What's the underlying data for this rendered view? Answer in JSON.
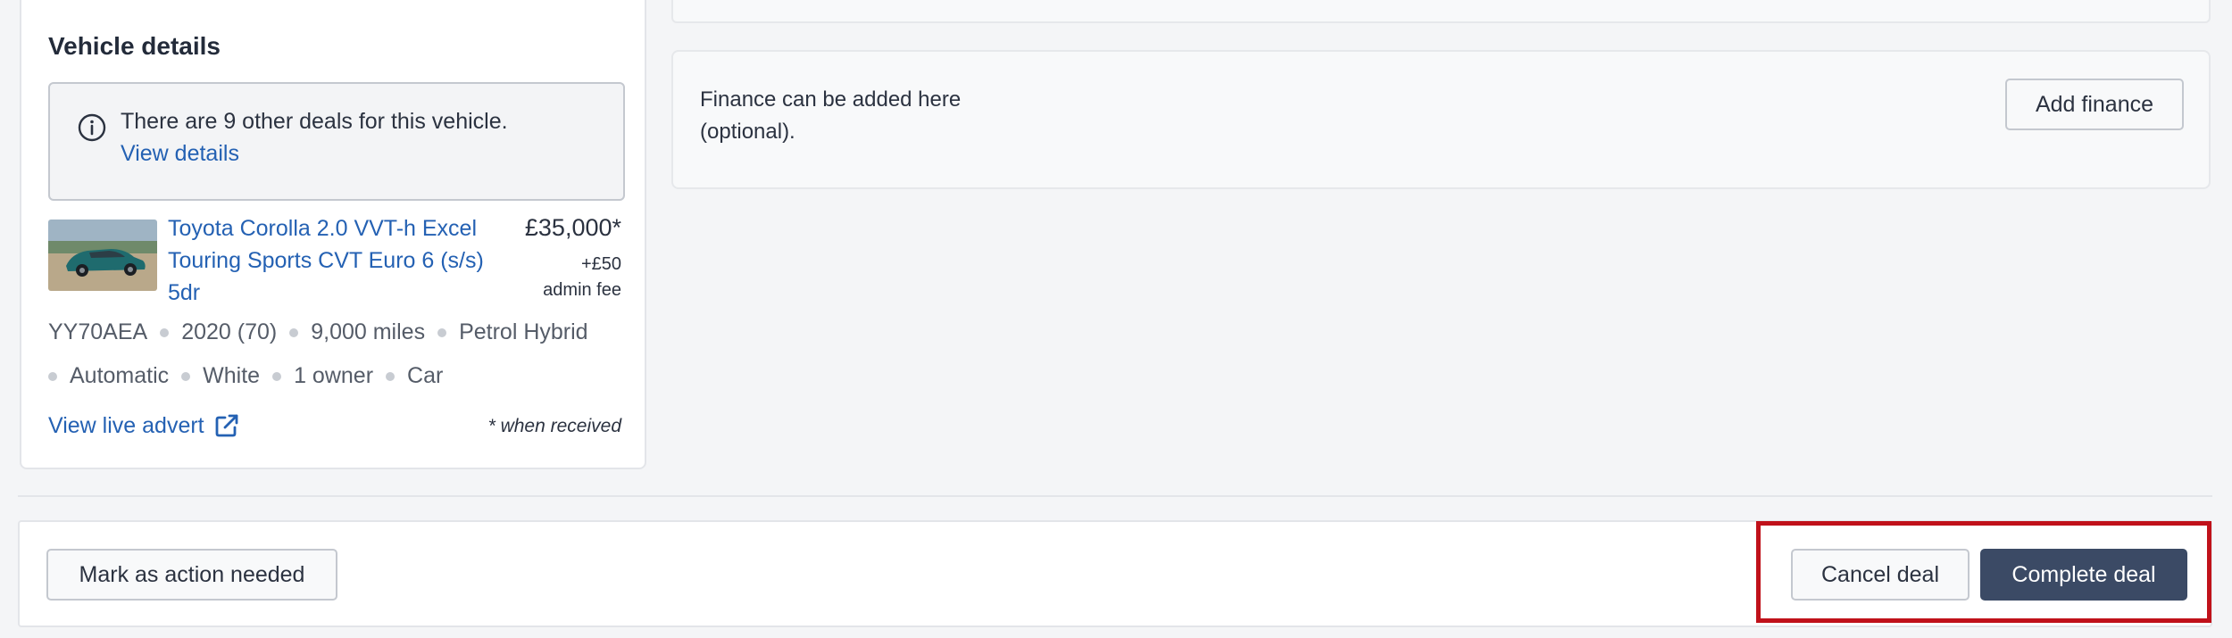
{
  "vehicle": {
    "title": "Vehicle details",
    "notice": {
      "text": "There are 9 other deals for this vehicle.",
      "link": "View details"
    },
    "car": {
      "name": "Toyota Corolla 2.0 VVT-h Excel Touring Sports CVT Euro 6 (s/s) 5dr",
      "price": "£35,000*",
      "fee_line1": "+£50",
      "fee_line2": "admin fee"
    },
    "specs_row1": [
      "YY70AEA",
      "2020 (70)",
      "9,000 miles",
      "Petrol Hybrid"
    ],
    "specs_row2": [
      "Automatic",
      "White",
      "1 owner",
      "Car"
    ],
    "live_advert": "View live advert",
    "footnote": "* when received"
  },
  "finance": {
    "text": "Finance can be added here (optional).",
    "button": "Add finance"
  },
  "actions": {
    "mark_action": "Mark as action needed",
    "cancel": "Cancel deal",
    "complete": "Complete deal"
  },
  "colors": {
    "link": "#2461b3",
    "primary_button": "#3b4a65",
    "highlight": "#c0111a"
  },
  "icons": [
    "info-icon",
    "external-link-icon"
  ]
}
